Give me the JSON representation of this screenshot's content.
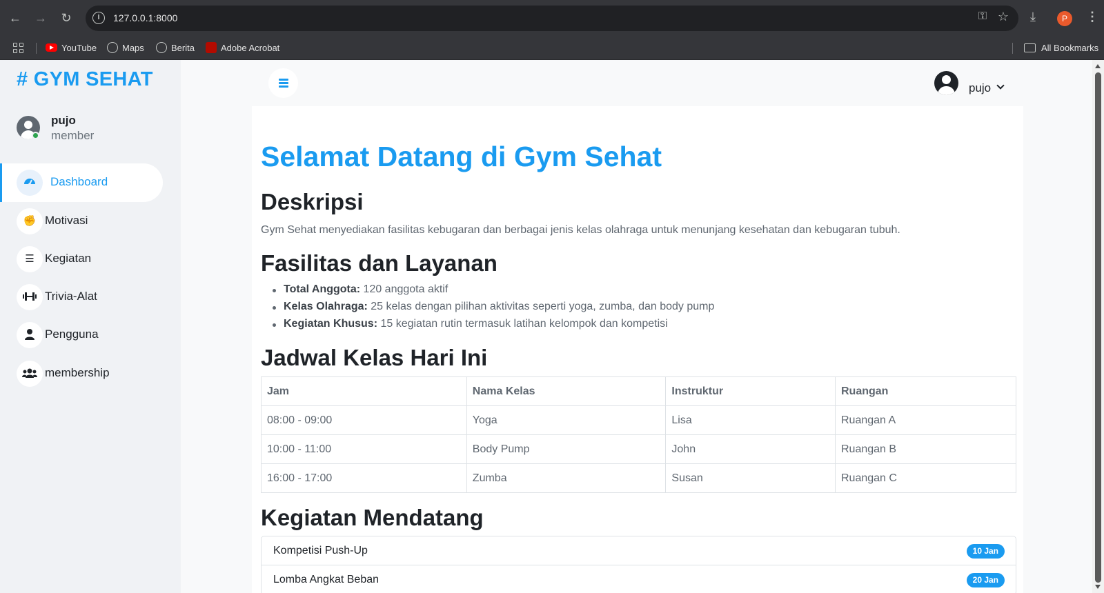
{
  "browser": {
    "url": "127.0.0.1:8000",
    "profile_initial": "P",
    "bookmarks": [
      {
        "label": "YouTube",
        "icon": "youtube-icon"
      },
      {
        "label": "Maps",
        "icon": "globe-icon"
      },
      {
        "label": "Berita",
        "icon": "globe-icon"
      },
      {
        "label": "Adobe Acrobat",
        "icon": "acrobat-icon"
      }
    ],
    "all_bookmarks": "All Bookmarks"
  },
  "sidebar": {
    "brand": "# GYM SEHAT",
    "user": {
      "name": "pujo",
      "role": "member"
    },
    "items": [
      {
        "label": "Dashboard",
        "icon": "dashboard-icon",
        "active": true
      },
      {
        "label": "Motivasi",
        "icon": "fist-icon"
      },
      {
        "label": "Kegiatan",
        "icon": "list-icon"
      },
      {
        "label": "Trivia-Alat",
        "icon": "dumbbell-icon"
      },
      {
        "label": "Pengguna",
        "icon": "user-icon"
      },
      {
        "label": "membership",
        "icon": "users-icon"
      }
    ]
  },
  "topbar": {
    "username": "pujo"
  },
  "main": {
    "title": "Selamat Datang di Gym Sehat",
    "description_heading": "Deskripsi",
    "description": "Gym Sehat menyediakan fasilitas kebugaran dan berbagai jenis kelas olahraga untuk menunjang kesehatan dan kebugaran tubuh.",
    "facilities_heading": "Fasilitas dan Layanan",
    "facilities": [
      {
        "label": "Total Anggota:",
        "value": " 120 anggota aktif"
      },
      {
        "label": "Kelas Olahraga:",
        "value": " 25 kelas dengan pilihan aktivitas seperti yoga, zumba, dan body pump"
      },
      {
        "label": "Kegiatan Khusus:",
        "value": " 15 kegiatan rutin termasuk latihan kelompok dan kompetisi"
      }
    ],
    "schedule_heading": "Jadwal Kelas Hari Ini",
    "schedule": {
      "columns": [
        "Jam",
        "Nama Kelas",
        "Instruktur",
        "Ruangan"
      ],
      "rows": [
        [
          "08:00 - 09:00",
          "Yoga",
          "Lisa",
          "Ruangan A"
        ],
        [
          "10:00 - 11:00",
          "Body Pump",
          "John",
          "Ruangan B"
        ],
        [
          "16:00 - 17:00",
          "Zumba",
          "Susan",
          "Ruangan C"
        ]
      ]
    },
    "events_heading": "Kegiatan Mendatang",
    "events": [
      {
        "name": "Kompetisi Push-Up",
        "date": "10 Jan"
      },
      {
        "name": "Lomba Angkat Beban",
        "date": "20 Jan"
      }
    ]
  },
  "colors": {
    "accent": "#1a9bf0",
    "sidebar_bg": "#f0f2f5",
    "online": "#2ea44f"
  }
}
